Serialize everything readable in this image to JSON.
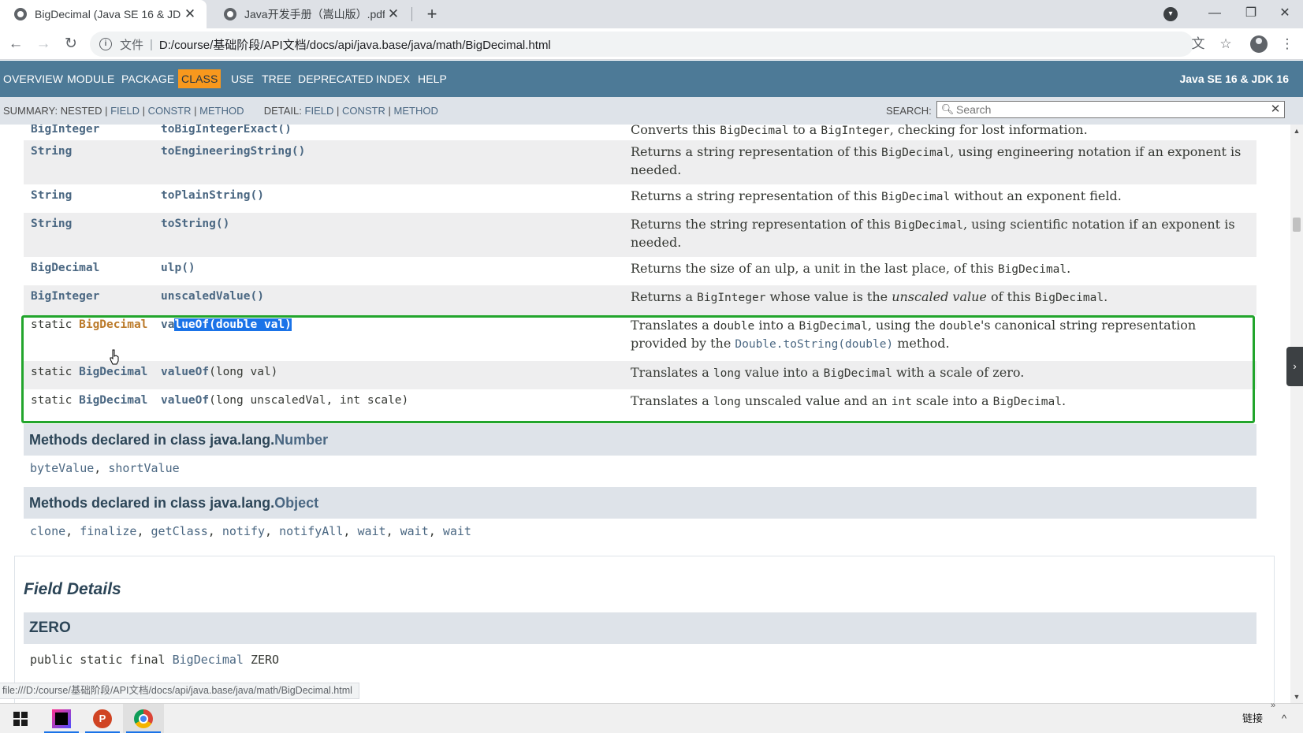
{
  "browser": {
    "tabs": [
      {
        "title": "BigDecimal (Java SE 16 & JDK",
        "close": "✕",
        "active": true
      },
      {
        "title": "Java开发手册（嵩山版）.pdf",
        "close": "✕",
        "active": false
      }
    ],
    "new_tab": "+",
    "window_controls": {
      "minimize": "—",
      "restore": "❐",
      "close": "✕"
    },
    "address": {
      "scheme_label": "文件",
      "divider": "|",
      "url": "D:/course/基础阶段/API文档/docs/api/java.base/java/math/BigDecimal.html"
    },
    "nav_icons": {
      "back": "←",
      "forward": "→",
      "reload": "↻"
    },
    "status_url": "file:///D:/course/基础阶段/API文档/docs/api/java.base/java/math/BigDecimal.html"
  },
  "javadoc": {
    "topnav": [
      "OVERVIEW",
      "MODULE",
      "PACKAGE",
      "CLASS",
      "USE",
      "TREE",
      "DEPRECATED",
      "INDEX",
      "HELP"
    ],
    "topnav_active": "CLASS",
    "product": "Java SE 16 & JDK 16",
    "subnav": {
      "summary_label": "SUMMARY:",
      "summary_items": [
        "NESTED",
        "FIELD",
        "CONSTR",
        "METHOD"
      ],
      "detail_label": "DETAIL:",
      "detail_items": [
        "FIELD",
        "CONSTR",
        "METHOD"
      ],
      "sep": "|",
      "search_label": "SEARCH:",
      "search_placeholder": "Search"
    },
    "method_rows": [
      {
        "type": "BigInteger",
        "name": "toBigIntegerExact",
        "args": "()",
        "desc": [
          "Converts this ",
          {
            "code": "BigDecimal"
          },
          " to a ",
          {
            "code": "BigInteger"
          },
          ", checking for lost information."
        ]
      },
      {
        "type": "String",
        "name": "toEngineeringString",
        "args": "()",
        "desc": [
          "Returns a string representation of this ",
          {
            "code": "BigDecimal"
          },
          ", using engineering notation if an exponent is needed."
        ]
      },
      {
        "type": "String",
        "name": "toPlainString",
        "args": "()",
        "desc": [
          "Returns a string representation of this ",
          {
            "code": "BigDecimal"
          },
          " without an exponent field."
        ]
      },
      {
        "type": "String",
        "name": "toString",
        "args": "()",
        "desc": [
          "Returns the string representation of this ",
          {
            "code": "BigDecimal"
          },
          ", using scientific notation if an exponent is needed."
        ]
      },
      {
        "type": "BigDecimal",
        "name": "ulp",
        "args": "()",
        "desc": [
          "Returns the size of an ulp, a unit in the last place, of this ",
          {
            "code": "BigDecimal"
          },
          "."
        ]
      },
      {
        "type": "BigInteger",
        "name": "unscaledValue",
        "args": "()",
        "desc": [
          "Returns a ",
          {
            "code": "BigInteger"
          },
          " whose value is the ",
          {
            "em": "unscaled value"
          },
          " of this ",
          {
            "code": "BigDecimal"
          },
          "."
        ]
      },
      {
        "modifier": "static",
        "type": "BigDecimal",
        "name": "valueOf",
        "args": "(double val)",
        "desc": [
          "Translates a ",
          {
            "code": "double"
          },
          " into a ",
          {
            "code": "BigDecimal"
          },
          ", using the ",
          {
            "code": "double"
          },
          "'s canonical string representation provided by the ",
          {
            "link": "Double.toString(double)"
          },
          " method."
        ]
      },
      {
        "modifier": "static",
        "type": "BigDecimal",
        "name": "valueOf",
        "args": "(long val)",
        "desc": [
          "Translates a ",
          {
            "code": "long"
          },
          " value into a ",
          {
            "code": "BigDecimal"
          },
          " with a scale of zero."
        ]
      },
      {
        "modifier": "static",
        "type": "BigDecimal",
        "name": "valueOf",
        "args": "(long unscaledVal, int scale)",
        "desc": [
          "Translates a ",
          {
            "code": "long"
          },
          " unscaled value and an ",
          {
            "code": "int"
          },
          " scale into a ",
          {
            "code": "BigDecimal"
          },
          "."
        ]
      }
    ],
    "selected_text": "lueOf(double val)",
    "inherited": [
      {
        "prefix": "Methods declared in class java.lang.",
        "class": "Number",
        "methods": [
          "byteValue",
          "shortValue"
        ]
      },
      {
        "prefix": "Methods declared in class java.lang.",
        "class": "Object",
        "methods": [
          "clone",
          "finalize",
          "getClass",
          "notify",
          "notifyAll",
          "wait",
          "wait",
          "wait"
        ]
      }
    ],
    "field_details_title": "Field Details",
    "field_zero": "ZERO",
    "field_zero_signature": {
      "mods": "public static final ",
      "type": "BigDecimal",
      "name": " ZERO"
    }
  },
  "taskbar": {
    "link_label": "链接",
    "chevron": "^",
    "more": "»"
  },
  "colors": {
    "nav_bg": "#4d7a97",
    "nav_active": "#f8981d",
    "subnav_bg": "#dee3e9",
    "link": "#4a6782",
    "highlight_box": "#22a52c",
    "selection": "#1a73e8"
  }
}
